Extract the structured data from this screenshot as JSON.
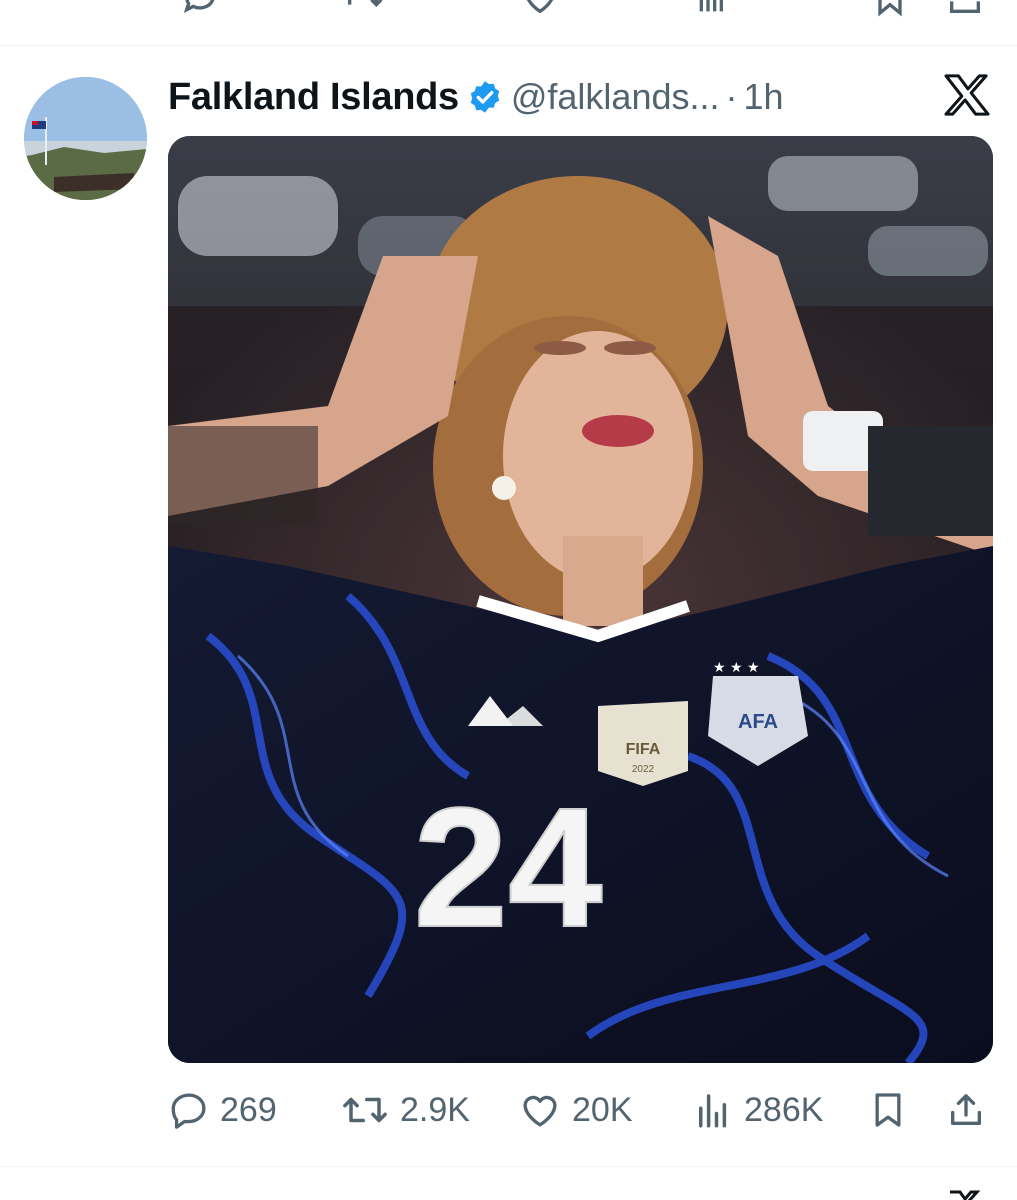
{
  "tweet": {
    "display_name": "Falkland Islands",
    "handle": "@falklands...",
    "separator": "·",
    "time": "1h",
    "media": {
      "jersey_number": "24",
      "badge_text": "FIFA",
      "badge_year": "2022",
      "crest_text": "AFA"
    },
    "actions": {
      "replies": "269",
      "reposts": "2.9K",
      "likes": "20K",
      "views": "286K"
    }
  },
  "icons": {
    "verified": "verified-badge-icon",
    "logo": "x-logo-icon",
    "reply": "reply-icon",
    "repost": "repost-icon",
    "like": "like-icon",
    "views": "views-icon",
    "bookmark": "bookmark-icon",
    "share": "share-icon"
  },
  "colors": {
    "verified_blue": "#1d9bf0",
    "muted_text": "#536471",
    "primary_text": "#0f1419"
  }
}
